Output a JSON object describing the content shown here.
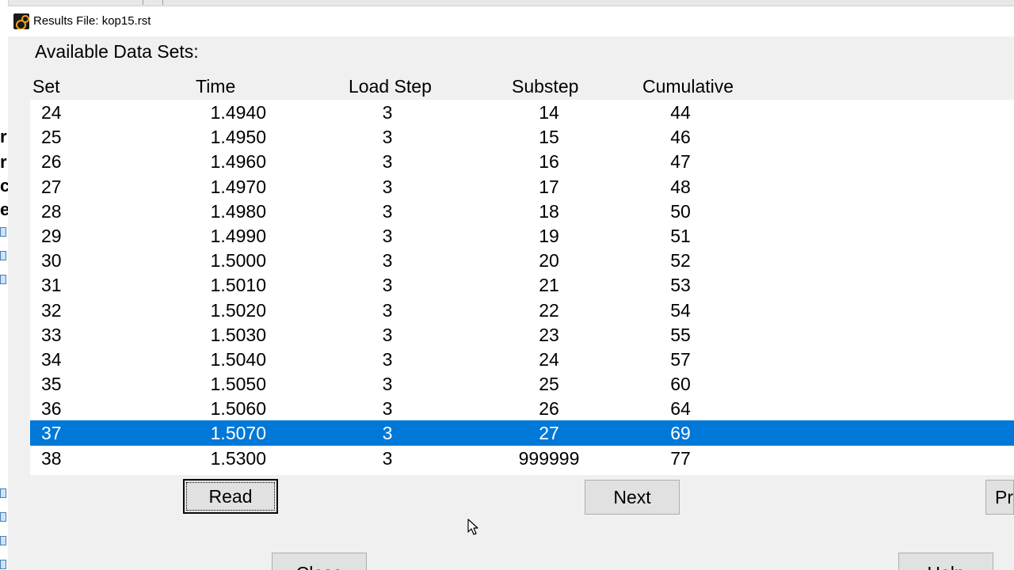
{
  "window": {
    "title": "Results File: kop15.rst"
  },
  "background_app": {
    "edge_fragments": [
      "r",
      "r",
      "c",
      "e"
    ]
  },
  "dialog": {
    "section_label": "Available Data Sets:",
    "columns": {
      "set": "Set",
      "time": "Time",
      "load_step": "Load Step",
      "substep": "Substep",
      "cumulative": "Cumulative"
    },
    "rows": [
      {
        "set": "24",
        "time": "1.4940",
        "load_step": "3",
        "substep": "14",
        "cumulative": "44"
      },
      {
        "set": "25",
        "time": "1.4950",
        "load_step": "3",
        "substep": "15",
        "cumulative": "46"
      },
      {
        "set": "26",
        "time": "1.4960",
        "load_step": "3",
        "substep": "16",
        "cumulative": "47"
      },
      {
        "set": "27",
        "time": "1.4970",
        "load_step": "3",
        "substep": "17",
        "cumulative": "48"
      },
      {
        "set": "28",
        "time": "1.4980",
        "load_step": "3",
        "substep": "18",
        "cumulative": "50"
      },
      {
        "set": "29",
        "time": "1.4990",
        "load_step": "3",
        "substep": "19",
        "cumulative": "51"
      },
      {
        "set": "30",
        "time": "1.5000",
        "load_step": "3",
        "substep": "20",
        "cumulative": "52"
      },
      {
        "set": "31",
        "time": "1.5010",
        "load_step": "3",
        "substep": "21",
        "cumulative": "53"
      },
      {
        "set": "32",
        "time": "1.5020",
        "load_step": "3",
        "substep": "22",
        "cumulative": "54"
      },
      {
        "set": "33",
        "time": "1.5030",
        "load_step": "3",
        "substep": "23",
        "cumulative": "55"
      },
      {
        "set": "34",
        "time": "1.5040",
        "load_step": "3",
        "substep": "24",
        "cumulative": "57"
      },
      {
        "set": "35",
        "time": "1.5050",
        "load_step": "3",
        "substep": "25",
        "cumulative": "60"
      },
      {
        "set": "36",
        "time": "1.5060",
        "load_step": "3",
        "substep": "26",
        "cumulative": "64"
      },
      {
        "set": "37",
        "time": "1.5070",
        "load_step": "3",
        "substep": "27",
        "cumulative": "69",
        "selected": true
      },
      {
        "set": "38",
        "time": "1.5300",
        "load_step": "3",
        "substep": "999999",
        "cumulative": "77"
      }
    ],
    "buttons": {
      "read": "Read",
      "next": "Next",
      "previous_partial": "Pr",
      "close_partial": "Close",
      "help_partial": "Help"
    }
  },
  "colors": {
    "selection": "#0078d7",
    "dialog_bg": "#f0f0f0",
    "button_bg": "#e1e1e1"
  }
}
